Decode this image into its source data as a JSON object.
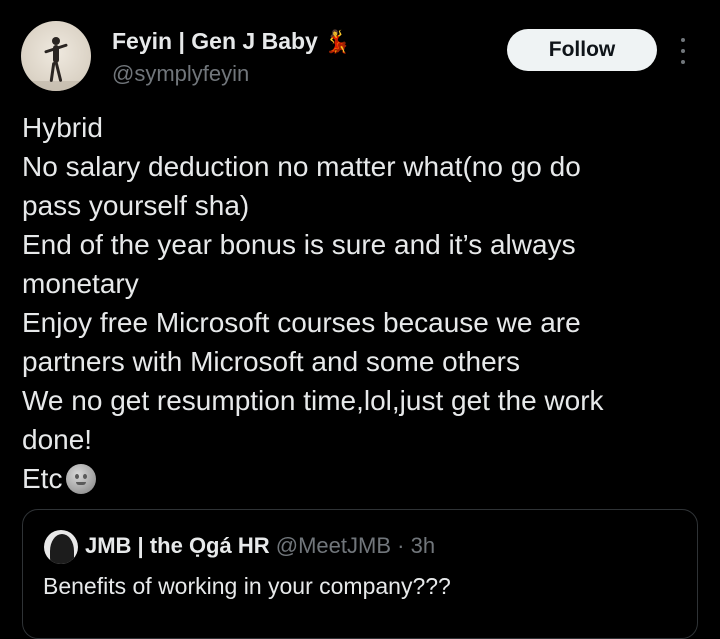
{
  "author": {
    "display_name": "Feyin | Gen J Baby",
    "name_emoji": "💃",
    "handle": "@symplyfeyin"
  },
  "actions": {
    "follow_label": "Follow",
    "more_icon": "more-vertical-icon"
  },
  "tweet": {
    "lines": [
      "Hybrid",
      "No salary deduction no matter what(no go do",
      "pass yourself sha)",
      "End of the year bonus is sure and it’s always",
      "monetary",
      "Enjoy free Microsoft courses because we are",
      "partners with Microsoft and some others",
      "We no get resumption time,lol,just get the work",
      "done!",
      "Etc"
    ],
    "end_emoji_icon": "moon-face-icon"
  },
  "quoted": {
    "display_name": "JMB | the Ọgá HR",
    "handle": "@MeetJMB",
    "separator": "·",
    "time": "3h",
    "text": "Benefits of working in your company???"
  },
  "colors": {
    "background": "#000000",
    "text": "#e7e9ea",
    "muted": "#71767b",
    "follow_bg": "#eff3f4",
    "border": "#2f3336"
  }
}
